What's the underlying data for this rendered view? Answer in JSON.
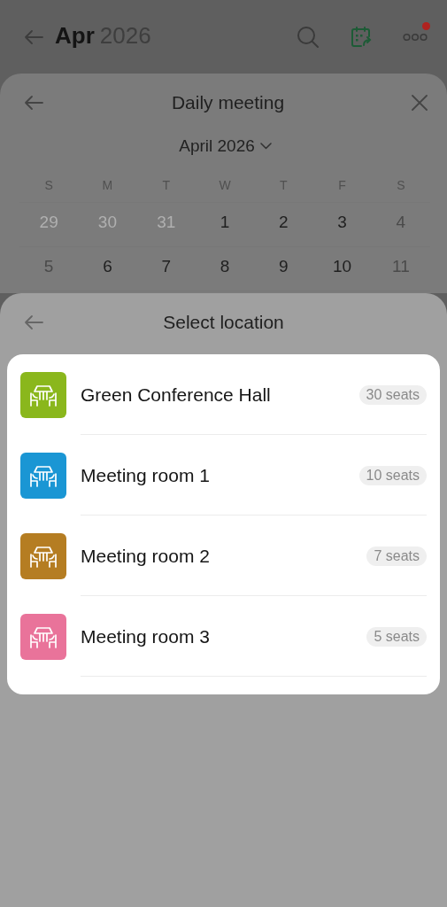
{
  "header": {
    "month": "Apr",
    "year": "2026",
    "has_notification": true
  },
  "meeting_sheet": {
    "title": "Daily meeting",
    "month_picker": "April 2026",
    "weekdays": [
      "S",
      "M",
      "T",
      "W",
      "T",
      "F",
      "S"
    ],
    "weeks": [
      [
        {
          "label": "29",
          "kind": "outside"
        },
        {
          "label": "30",
          "kind": "outside"
        },
        {
          "label": "31",
          "kind": "outside"
        },
        {
          "label": "1",
          "kind": "day"
        },
        {
          "label": "2",
          "kind": "day"
        },
        {
          "label": "3",
          "kind": "day"
        },
        {
          "label": "4",
          "kind": "weekend"
        }
      ],
      [
        {
          "label": "5",
          "kind": "weekend"
        },
        {
          "label": "6",
          "kind": "day"
        },
        {
          "label": "7",
          "kind": "day"
        },
        {
          "label": "8",
          "kind": "day"
        },
        {
          "label": "9",
          "kind": "day"
        },
        {
          "label": "10",
          "kind": "day"
        },
        {
          "label": "11",
          "kind": "weekend"
        }
      ]
    ]
  },
  "location_sheet": {
    "title": "Select location",
    "rooms": [
      {
        "name": "Green Conference Hall",
        "seats": "30 seats",
        "color": "#8ab71c"
      },
      {
        "name": "Meeting room 1",
        "seats": "10 seats",
        "color": "#1a96d4"
      },
      {
        "name": "Meeting room 2",
        "seats": "7 seats",
        "color": "#b57d22"
      },
      {
        "name": "Meeting room 3",
        "seats": "5 seats",
        "color": "#e9739a"
      }
    ]
  }
}
